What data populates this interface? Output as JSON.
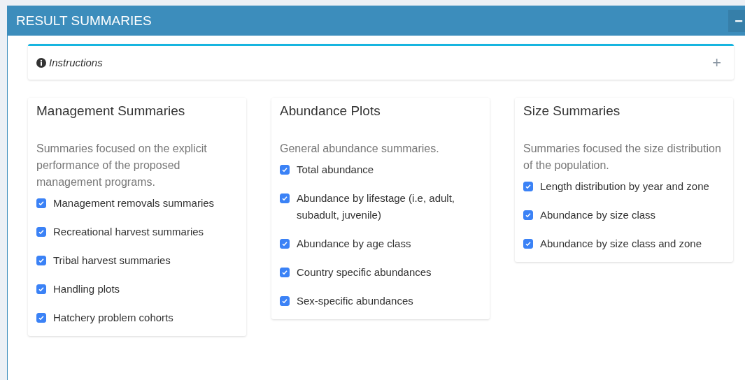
{
  "panel": {
    "title": "RESULT SUMMARIES",
    "collapse_button": "−"
  },
  "instructions": {
    "label": "Instructions",
    "expand_button": "+"
  },
  "cards": [
    {
      "title": "Management Summaries",
      "description": "Summaries focused on the explicit performance of the proposed management programs.",
      "options": [
        {
          "label": "Management removals summaries",
          "checked": true
        },
        {
          "label": "Recreational harvest summaries",
          "checked": true
        },
        {
          "label": "Tribal harvest summaries",
          "checked": true
        },
        {
          "label": "Handling plots",
          "checked": true
        },
        {
          "label": "Hatchery problem cohorts",
          "checked": true
        }
      ]
    },
    {
      "title": "Abundance Plots",
      "description": "General abundance summaries.",
      "options": [
        {
          "label": "Total abundance",
          "checked": true
        },
        {
          "label": "Abundance by lifestage (i.e, adult, subadult, juvenile)",
          "checked": true
        },
        {
          "label": "Abundance by age class",
          "checked": true
        },
        {
          "label": "Country specific abundances",
          "checked": true
        },
        {
          "label": "Sex-specific abundances",
          "checked": true
        }
      ]
    },
    {
      "title": "Size Summaries",
      "description": "Summaries focused the size distribution of the population.",
      "options": [
        {
          "label": "Length distribution by year and zone",
          "checked": true
        },
        {
          "label": "Abundance by size class",
          "checked": true
        },
        {
          "label": "Abundance by size class and zone",
          "checked": true
        }
      ]
    }
  ]
}
